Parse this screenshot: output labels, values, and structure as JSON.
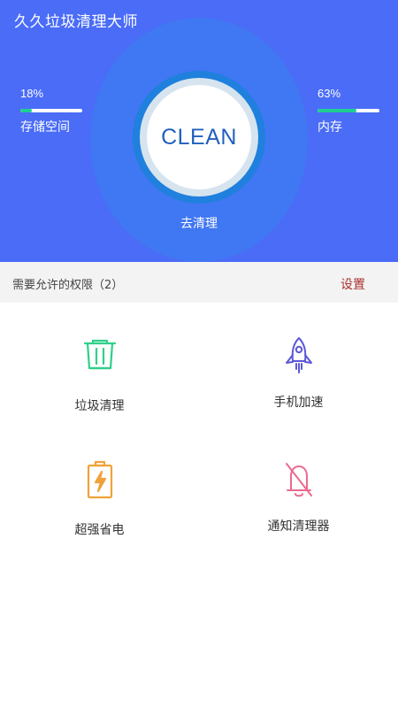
{
  "app": {
    "title": "久久垃圾清理大师"
  },
  "header": {
    "clean_label": "CLEAN",
    "go_clean": "去清理",
    "accent": "#4a6cf7"
  },
  "storage": {
    "percent": "18%",
    "fraction": 0.18,
    "label": "存储空间"
  },
  "memory": {
    "percent": "63%",
    "fraction": 0.63,
    "label": "内存"
  },
  "permissions": {
    "text": "需要允许的权限（2）",
    "settings_label": "设置"
  },
  "features": [
    {
      "label": "垃圾清理",
      "icon": "trash-can-icon",
      "color": "#2fd08a"
    },
    {
      "label": "手机加速",
      "icon": "rocket-icon",
      "color": "#5b58d6"
    },
    {
      "label": "超强省电",
      "icon": "battery-charging-icon",
      "color": "#f0a23a"
    },
    {
      "label": "通知清理器",
      "icon": "bell-off-icon",
      "color": "#ec6a8e"
    }
  ]
}
